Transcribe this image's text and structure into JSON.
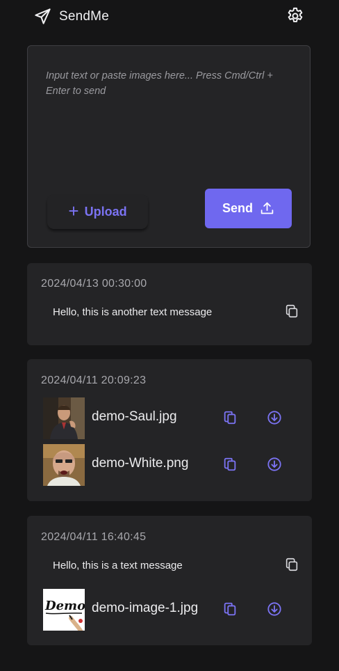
{
  "app": {
    "title": "SendMe"
  },
  "composer": {
    "placeholder": "Input text or paste images here... Press Cmd/Ctrl + Enter to send",
    "upload_label": "Upload",
    "send_label": "Send"
  },
  "colors": {
    "accent": "#6f68ef",
    "background": "#151516",
    "card": "#242426"
  },
  "messages": [
    {
      "time": "2024/04/13 00:30:00",
      "text": "Hello, this is another text message",
      "files": []
    },
    {
      "time": "2024/04/11 20:09:23",
      "text": "",
      "files": [
        {
          "name": "demo-Saul.jpg"
        },
        {
          "name": "demo-White.png"
        }
      ]
    },
    {
      "time": "2024/04/11 16:40:45",
      "text": "Hello, this is a text message",
      "files": [
        {
          "name": "demo-image-1.jpg",
          "thumb_text": "Demo"
        }
      ]
    }
  ]
}
